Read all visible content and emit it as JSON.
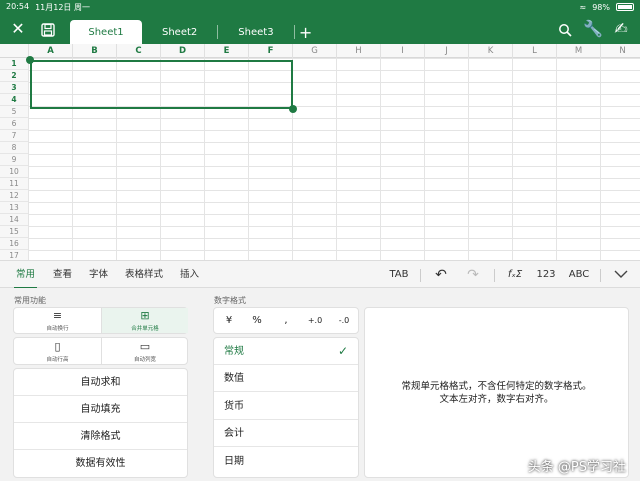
{
  "status": {
    "time": "20:54",
    "date": "11月12日 周一",
    "battery": "98%"
  },
  "sheets": [
    "Sheet1",
    "Sheet2",
    "Sheet3"
  ],
  "columns": [
    "A",
    "B",
    "C",
    "D",
    "E",
    "F",
    "G",
    "H",
    "I",
    "J",
    "K",
    "L",
    "M",
    "N"
  ],
  "rows": [
    "1",
    "2",
    "3",
    "4",
    "5",
    "6",
    "7",
    "8",
    "9",
    "10",
    "11",
    "12",
    "13",
    "14",
    "15",
    "16",
    "17"
  ],
  "ribbon": {
    "tabs": [
      "常用",
      "查看",
      "字体",
      "表格样式",
      "插入"
    ],
    "tab_label": "TAB",
    "fx_label": "fₓΣ",
    "num_label": "123",
    "abc_label": "ABC"
  },
  "common": {
    "title": "常用功能",
    "wrap_text": "自动换行",
    "merge_cells": "合并单元格",
    "auto_row_height": "自动行高",
    "auto_col_width": "自动列宽",
    "functions": [
      "自动求和",
      "自动填充",
      "清除格式",
      "数据有效性"
    ]
  },
  "number_format": {
    "title": "数字格式",
    "symbols": [
      "¥",
      "%",
      ",",
      "+.0",
      "-.0"
    ],
    "formats": [
      "常规",
      "数值",
      "货币",
      "会计",
      "日期"
    ],
    "selected": "常规",
    "description_line1": "常规单元格格式，不含任何特定的数字格式。",
    "description_line2": "文本左对齐，数字右对齐。"
  },
  "watermark": "头条 @PS学习社"
}
